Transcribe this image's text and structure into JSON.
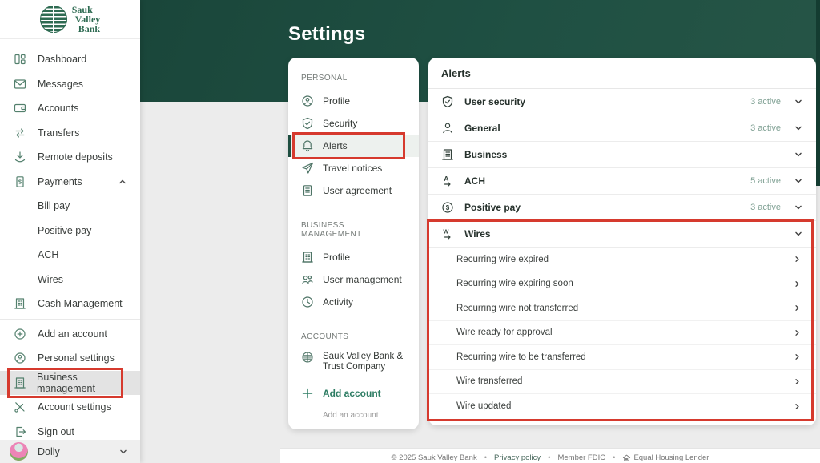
{
  "brand": {
    "line1": "Sauk",
    "line2": "Valley",
    "line3": "Bank"
  },
  "header": {
    "title": "Settings"
  },
  "colors": {
    "header_green": "#1f5043",
    "accent_green": "#2e6b52",
    "link_green": "#2e7d64",
    "badge_green": "#7fa093",
    "highlight_red": "#d63a2e",
    "active_row_gray": "#e3e3e3"
  },
  "sidebar": {
    "items": [
      {
        "label": "Dashboard",
        "icon": "dashboard-icon"
      },
      {
        "label": "Messages",
        "icon": "mail-icon"
      },
      {
        "label": "Accounts",
        "icon": "wallet-icon"
      },
      {
        "label": "Transfers",
        "icon": "transfer-icon"
      },
      {
        "label": "Remote deposits",
        "icon": "download-icon"
      },
      {
        "label": "Payments",
        "icon": "bill-icon",
        "expanded": true
      },
      {
        "label": "Bill pay",
        "sub": true
      },
      {
        "label": "Positive pay",
        "sub": true
      },
      {
        "label": "ACH",
        "sub": true
      },
      {
        "label": "Wires",
        "sub": true
      },
      {
        "label": "Cash Management",
        "icon": "bank-icon"
      }
    ],
    "items2": [
      {
        "label": "Add an account",
        "icon": "plus-circle-icon"
      },
      {
        "label": "Personal settings",
        "icon": "person-circle-icon"
      },
      {
        "label": "Business management",
        "icon": "bank-icon",
        "active": true,
        "highlighted": true
      },
      {
        "label": "Account settings",
        "icon": "tools-icon"
      },
      {
        "label": "Sign out",
        "icon": "signout-icon"
      }
    ],
    "user": {
      "name": "Dolly"
    }
  },
  "settings_nav": {
    "personal": {
      "label": "PERSONAL",
      "items": [
        {
          "label": "Profile",
          "icon": "person-circle-icon"
        },
        {
          "label": "Security",
          "icon": "shield-check-icon"
        },
        {
          "label": "Alerts",
          "icon": "bell-icon",
          "active": true,
          "highlighted": true
        },
        {
          "label": "Travel notices",
          "icon": "plane-icon"
        },
        {
          "label": "User agreement",
          "icon": "document-icon"
        }
      ]
    },
    "business": {
      "label": "BUSINESS MANAGEMENT",
      "items": [
        {
          "label": "Profile",
          "icon": "bank-icon"
        },
        {
          "label": "User management",
          "icon": "people-icon"
        },
        {
          "label": "Activity",
          "icon": "clock-icon"
        }
      ]
    },
    "accounts": {
      "label": "ACCOUNTS",
      "bank_name": "Sauk Valley Bank & Trust Company",
      "add_label": "Add account",
      "add_sub": "Add an account"
    }
  },
  "alerts": {
    "title": "Alerts",
    "groups": [
      {
        "label": "User security",
        "badge": "3 active",
        "icon": "shield-check-icon"
      },
      {
        "label": "General",
        "badge": "3 active",
        "icon": "person-icon"
      },
      {
        "label": "Business",
        "badge": "",
        "icon": "bank-icon"
      },
      {
        "label": "ACH",
        "badge": "5 active",
        "icon": "ach-icon"
      },
      {
        "label": "Positive pay",
        "badge": "3 active",
        "icon": "positive-pay-icon"
      },
      {
        "label": "Wires",
        "badge": "",
        "icon": "wires-icon",
        "expanded": true,
        "highlighted": true
      }
    ],
    "wire_items": [
      "Recurring wire expired",
      "Recurring wire expiring soon",
      "Recurring wire not transferred",
      "Wire ready for approval",
      "Recurring wire to be transferred",
      "Wire transferred",
      "Wire updated"
    ]
  },
  "footer": {
    "copyright": "© 2025 Sauk Valley Bank",
    "privacy": "Privacy policy",
    "fdic": "Member FDIC",
    "ehl": "Equal Housing Lender",
    "sep": "•"
  }
}
